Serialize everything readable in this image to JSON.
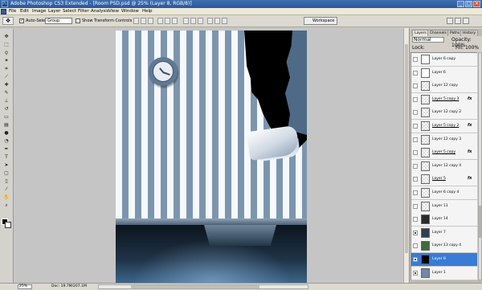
{
  "window": {
    "title": "Adobe Photoshop CS3 Extended - [Room PSD.psd @ 25% (Layer 8, RGB/8)]",
    "app_icon": "Ps",
    "buttons": [
      "_",
      "□",
      "×"
    ]
  },
  "menu": {
    "items": [
      "File",
      "Edit",
      "Image",
      "Layer",
      "Select",
      "Filter",
      "Analysis",
      "View",
      "Window",
      "Help"
    ]
  },
  "options": {
    "auto_select_label": "Auto-Select:",
    "auto_select_checked": true,
    "auto_select_value": "Group",
    "show_transform_label": "Show Transform Controls",
    "show_transform_checked": false,
    "workspace_label": "Workspace"
  },
  "tools": [
    {
      "icon": "move-icon",
      "glyph": "✥"
    },
    {
      "icon": "marquee-icon",
      "glyph": "⬚"
    },
    {
      "icon": "lasso-icon",
      "glyph": "ϙ"
    },
    {
      "icon": "magic-wand-icon",
      "glyph": "✦"
    },
    {
      "icon": "crop-icon",
      "glyph": "⌗"
    },
    {
      "icon": "slice-icon",
      "glyph": "⟋"
    },
    {
      "icon": "healing-icon",
      "glyph": "✚"
    },
    {
      "icon": "brush-icon",
      "glyph": "✎"
    },
    {
      "icon": "stamp-icon",
      "glyph": "⊥"
    },
    {
      "icon": "history-brush-icon",
      "glyph": "↺"
    },
    {
      "icon": "eraser-icon",
      "glyph": "▭"
    },
    {
      "icon": "gradient-icon",
      "glyph": "▤"
    },
    {
      "icon": "blur-icon",
      "glyph": "●"
    },
    {
      "icon": "dodge-icon",
      "glyph": "◔"
    },
    {
      "icon": "pen-icon",
      "glyph": "✒"
    },
    {
      "icon": "type-icon",
      "glyph": "T"
    },
    {
      "icon": "path-select-icon",
      "glyph": "➤"
    },
    {
      "icon": "shape-icon",
      "glyph": "▢"
    },
    {
      "icon": "notes-icon",
      "glyph": "▯"
    },
    {
      "icon": "eyedropper-icon",
      "glyph": "⁄"
    },
    {
      "icon": "hand-icon",
      "glyph": "✋"
    },
    {
      "icon": "zoom-icon",
      "glyph": "⌕"
    }
  ],
  "panel": {
    "tabs": [
      "Layers",
      "Channels",
      "Paths",
      "History"
    ],
    "active_tab": "Layers",
    "blend_mode": "Normal",
    "opacity_label": "Opacity:",
    "opacity_value": "100%",
    "lock_label": "Lock:",
    "fill_label": "Fill:",
    "fill_value": "100%",
    "layers": [
      {
        "name": "Layer 6 copy",
        "visible": false,
        "fx": false,
        "thumb": "#ffffff",
        "selected": false
      },
      {
        "name": "Layer 6",
        "visible": false,
        "fx": false,
        "thumb": "#ffffff",
        "selected": false
      },
      {
        "name": "Layer 12 copy",
        "visible": false,
        "fx": false,
        "thumb": "",
        "selected": false
      },
      {
        "name": "Layer 5 copy 3",
        "visible": false,
        "fx": true,
        "thumb": "",
        "selected": false
      },
      {
        "name": "Layer 12 copy 2",
        "visible": false,
        "fx": false,
        "thumb": "",
        "selected": false
      },
      {
        "name": "Layer 5 copy 2",
        "visible": false,
        "fx": true,
        "thumb": "",
        "selected": false
      },
      {
        "name": "Layer 12 copy 3",
        "visible": false,
        "fx": false,
        "thumb": "",
        "selected": false
      },
      {
        "name": "Layer 5 copy",
        "visible": false,
        "fx": true,
        "thumb": "",
        "selected": false
      },
      {
        "name": "Layer 12 copy 4",
        "visible": false,
        "fx": false,
        "thumb": "",
        "selected": false
      },
      {
        "name": "Layer 5",
        "visible": false,
        "fx": true,
        "thumb": "",
        "selected": false
      },
      {
        "name": "Layer 6 copy 4",
        "visible": false,
        "fx": false,
        "thumb": "",
        "selected": false
      },
      {
        "name": "Layer 11",
        "visible": false,
        "fx": false,
        "thumb": "",
        "selected": false
      },
      {
        "name": "Layer 14",
        "visible": false,
        "fx": false,
        "thumb": "#2a2a2a",
        "selected": false
      },
      {
        "name": "Layer 7",
        "visible": true,
        "fx": false,
        "thumb": "#2f4050",
        "selected": false
      },
      {
        "name": "Layer 13 copy 4",
        "visible": false,
        "fx": false,
        "thumb": "#3f6a3f",
        "selected": false
      },
      {
        "name": "Layer 8",
        "visible": true,
        "fx": false,
        "thumb": "#000000",
        "selected": true
      },
      {
        "name": "Layer 1",
        "visible": true,
        "fx": false,
        "thumb": "#6f8aa6",
        "selected": false
      }
    ]
  },
  "status": {
    "zoom": "25%",
    "doc": "Doc: 19.7M/207.1M"
  }
}
